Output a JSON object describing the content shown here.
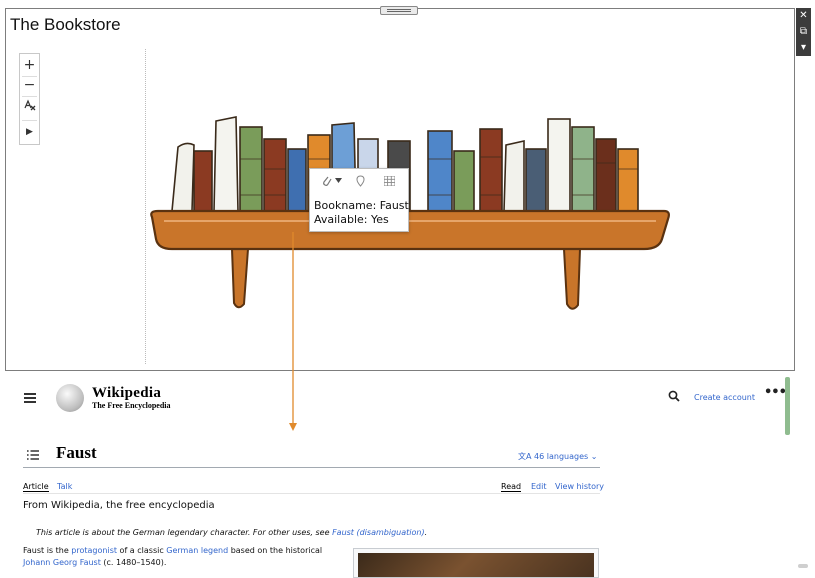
{
  "app": {
    "title": "The Bookstore",
    "zoom_in": "+",
    "zoom_out": "−",
    "play": "▶"
  },
  "tooltip": {
    "lines": [
      "Bookname: Faust",
      "Available: Yes"
    ]
  },
  "colors": {
    "connector": "#e08a2c",
    "link": "#3366cc",
    "shelf": "#c9752a"
  },
  "icons": {
    "side_toolbar": [
      "close-icon",
      "popout-icon",
      "dropdown-icon"
    ],
    "tooltip": [
      "attachment-icon",
      "chevron-down-icon",
      "pin-icon",
      "grid-icon"
    ]
  },
  "wiki": {
    "wordmark": "Wikipedia",
    "tagline": "The Free Encyclopedia",
    "create_account": "Create account",
    "more": "•••",
    "article_title": "Faust",
    "languages": "46 languages",
    "tabs_left": [
      "Article",
      "Talk"
    ],
    "tabs_right": [
      "Read",
      "Edit",
      "View history"
    ],
    "from": "From Wikipedia, the free encyclopedia",
    "hatnote_prefix": "This article is about the German legendary character. For other uses, see",
    "hatnote_link": "Faust (disambiguation)",
    "hatnote_suffix": ".",
    "lead_1": "Faust is the",
    "lead_link_1": "protagonist",
    "lead_2": "of a classic",
    "lead_link_2": "German legend",
    "lead_3": "based on the historical",
    "lead_link_3": "Johann Georg Faust",
    "lead_4": "(c. 1480–1540)."
  }
}
